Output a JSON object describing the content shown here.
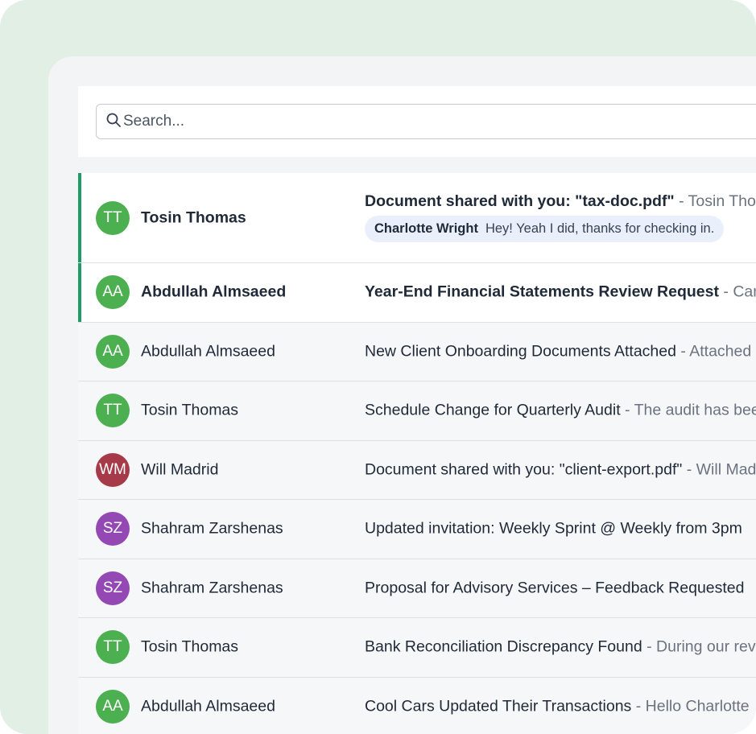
{
  "search": {
    "placeholder": "Search..."
  },
  "colors": {
    "green": "#4caf50",
    "red": "#a63a48",
    "purple": "#9348b3",
    "accent": "#1f9c66"
  },
  "messages": [
    {
      "initials": "TT",
      "sender": "Tosin Thomas",
      "subject": "Document shared with you: \"tax-doc.pdf\"",
      "preview": " - Tosin Thomas",
      "unread": true,
      "avatar_color": "#4caf50",
      "chat": {
        "author": "Charlotte Wright",
        "text": "Hey! Yeah I did, thanks for checking in."
      }
    },
    {
      "initials": "AA",
      "sender": "Abdullah Almsaeed",
      "subject": "Year-End Financial Statements Review Request",
      "preview": " - Can",
      "unread": true,
      "avatar_color": "#4caf50"
    },
    {
      "initials": "AA",
      "sender": "Abdullah Almsaeed",
      "subject": "New Client Onboarding Documents Attached",
      "preview": " - Attached",
      "unread": false,
      "avatar_color": "#4caf50"
    },
    {
      "initials": "TT",
      "sender": "Tosin Thomas",
      "subject": "Schedule Change for Quarterly Audit",
      "preview": " - The audit has been",
      "unread": false,
      "avatar_color": "#4caf50"
    },
    {
      "initials": "WM",
      "sender": "Will Madrid",
      "subject": "Document shared with you: \"client-export.pdf\"",
      "preview": " - Will Madrid",
      "unread": false,
      "avatar_color": "#a63a48"
    },
    {
      "initials": "SZ",
      "sender": "Shahram Zarshenas",
      "subject": "Updated invitation: Weekly Sprint @ Weekly from 3pm",
      "preview": "",
      "unread": false,
      "avatar_color": "#9348b3"
    },
    {
      "initials": "SZ",
      "sender": "Shahram Zarshenas",
      "subject": "Proposal for Advisory Services – Feedback Requested",
      "preview": "",
      "unread": false,
      "avatar_color": "#9348b3"
    },
    {
      "initials": "TT",
      "sender": "Tosin Thomas",
      "subject": "Bank Reconciliation Discrepancy Found",
      "preview": " - During our review",
      "unread": false,
      "avatar_color": "#4caf50"
    },
    {
      "initials": "AA",
      "sender": "Abdullah Almsaeed",
      "subject": "Cool Cars Updated Their Transactions",
      "preview": " - Hello Charlotte",
      "unread": false,
      "avatar_color": "#4caf50"
    }
  ]
}
